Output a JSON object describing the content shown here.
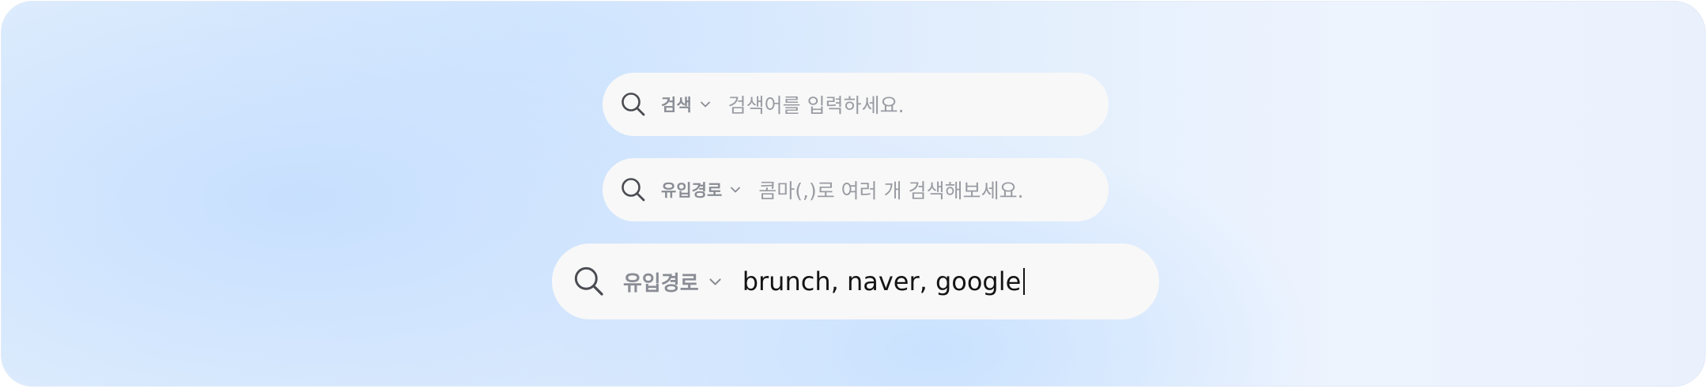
{
  "search_bars": [
    {
      "scope_label": "검색",
      "placeholder": "검색어를 입력하세요.",
      "value": ""
    },
    {
      "scope_label": "유입경로",
      "placeholder": "콤마(,)로 여러 개 검색해보세요.",
      "value": ""
    },
    {
      "scope_label": "유입경로",
      "placeholder": "",
      "value": "brunch, naver, google"
    }
  ],
  "icons": {
    "search": "search-icon",
    "dropdown": "chevron-down-icon"
  },
  "colors": {
    "bar_background": "#f8f8f8",
    "label_gray": "#8a8d95",
    "placeholder_gray": "#9a9ca3",
    "icon_dark": "#4a4c52",
    "text_dark": "#141414"
  }
}
